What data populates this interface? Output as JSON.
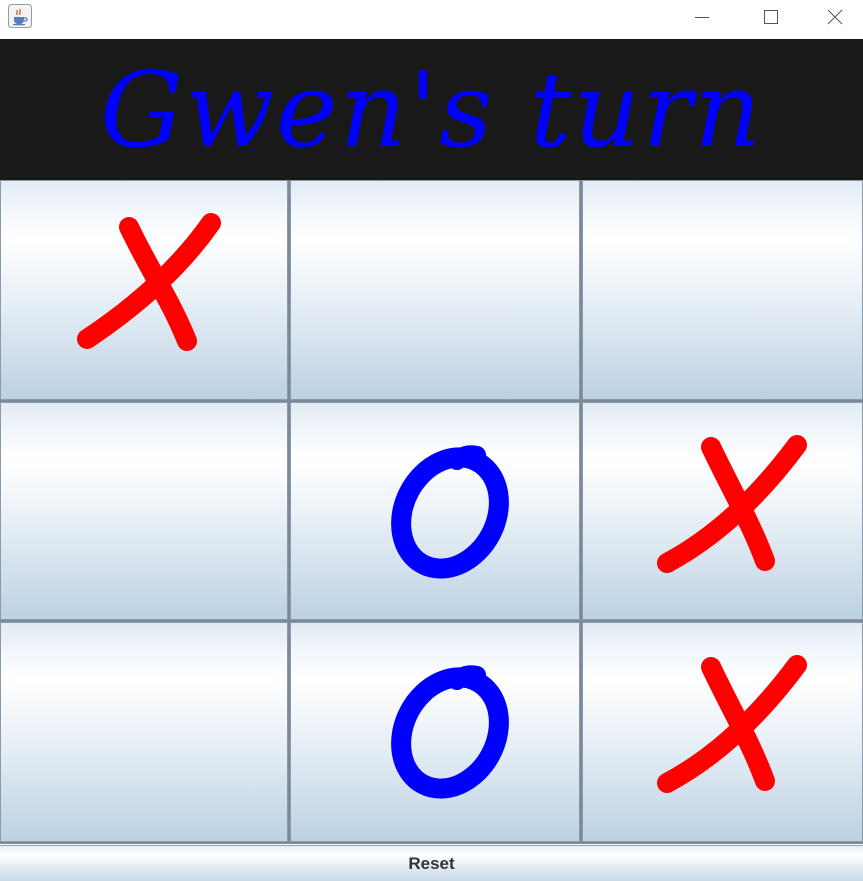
{
  "window": {
    "title_icon": "java-cup-icon",
    "controls": {
      "minimize_icon": "minimize-icon",
      "maximize_icon": "maximize-icon",
      "close_icon": "close-icon"
    }
  },
  "header": {
    "text": "Gwen's turn",
    "text_color": "#0000ff",
    "background": "#191919"
  },
  "board": {
    "cells": [
      {
        "mark": "X"
      },
      {
        "mark": ""
      },
      {
        "mark": ""
      },
      {
        "mark": ""
      },
      {
        "mark": "O"
      },
      {
        "mark": "X"
      },
      {
        "mark": ""
      },
      {
        "mark": "O"
      },
      {
        "mark": "X"
      }
    ],
    "x_color": "#ff0000",
    "o_color": "#0000ff"
  },
  "reset": {
    "label": "Reset"
  }
}
